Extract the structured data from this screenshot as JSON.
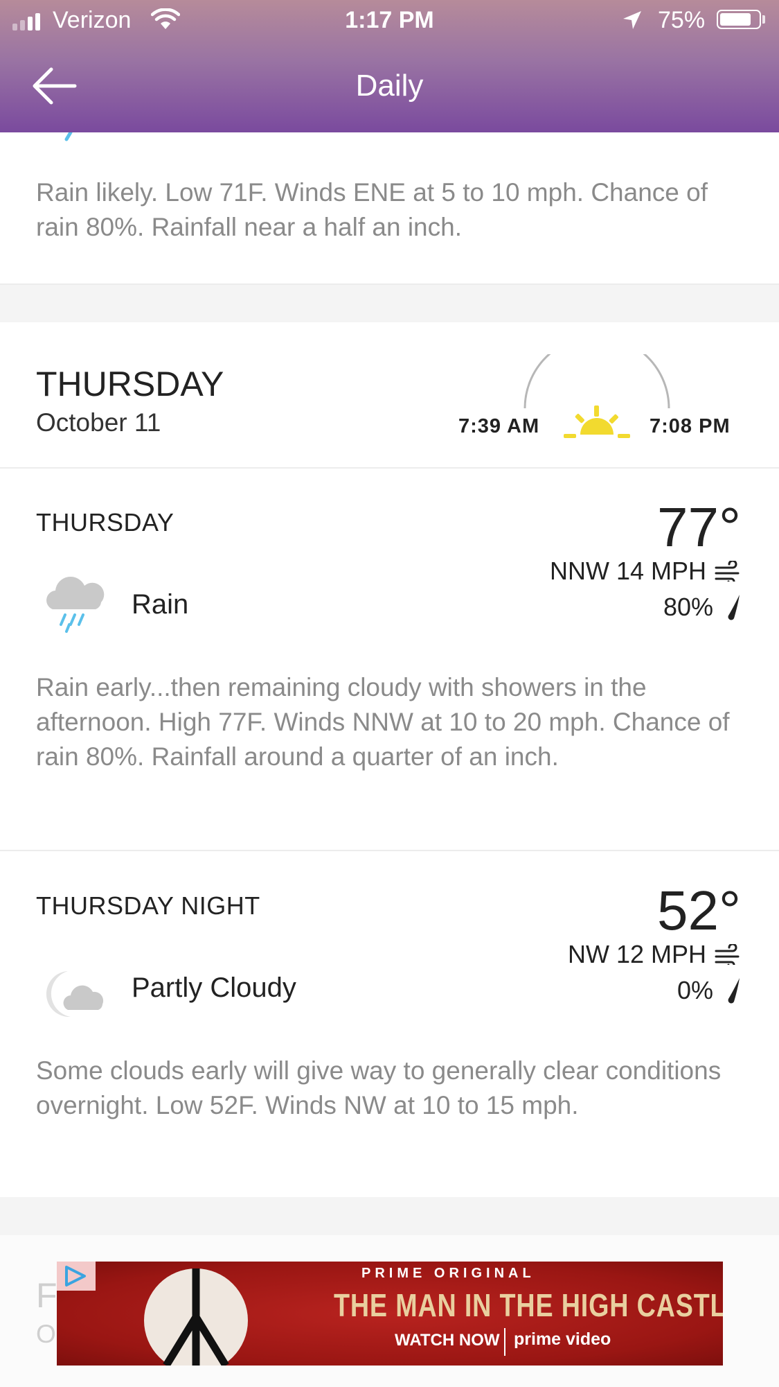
{
  "status_bar": {
    "carrier": "Verizon",
    "time": "1:17 PM",
    "battery": "75%",
    "battery_level": 0.75
  },
  "nav": {
    "title": "Daily"
  },
  "previous_card": {
    "description": "Rain likely. Low 71F. Winds ENE at 5 to 10 mph. Chance of rain 80%. Rainfall near a half an inch."
  },
  "day_card": {
    "day": "THURSDAY",
    "date": "October 11",
    "sunrise": "7:39 AM",
    "sunset": "7:08 PM",
    "sun_color": "#f2da2f"
  },
  "periods": [
    {
      "label": "THURSDAY",
      "temperature": "77°",
      "wind": "NNW 14 MPH",
      "precip": "80%",
      "condition": "Rain",
      "condition_icon": "rain-cloud-icon",
      "description": "Rain early...then remaining cloudy with showers in the afternoon. High 77F. Winds NNW at 10 to 20 mph. Chance of rain 80%. Rainfall around a quarter of an inch."
    },
    {
      "label": "THURSDAY NIGHT",
      "temperature": "52°",
      "wind": "NW 12 MPH",
      "precip": "0%",
      "condition": "Partly Cloudy",
      "condition_icon": "partly-cloudy-night-icon",
      "description": "Some clouds early will give way to generally clear conditions overnight. Low 52F. Winds NW at 10 to 15 mph."
    }
  ],
  "ad": {
    "kicker": "PRIME ORIGINAL",
    "headline": "THE MAN IN THE HIGH CASTLE",
    "cta": "WATCH NOW",
    "brand": "prime video"
  },
  "colors": {
    "header_top": "#b68b9a",
    "header_bottom": "#7a4a9e",
    "rain_drop": "#5bc0ea"
  }
}
